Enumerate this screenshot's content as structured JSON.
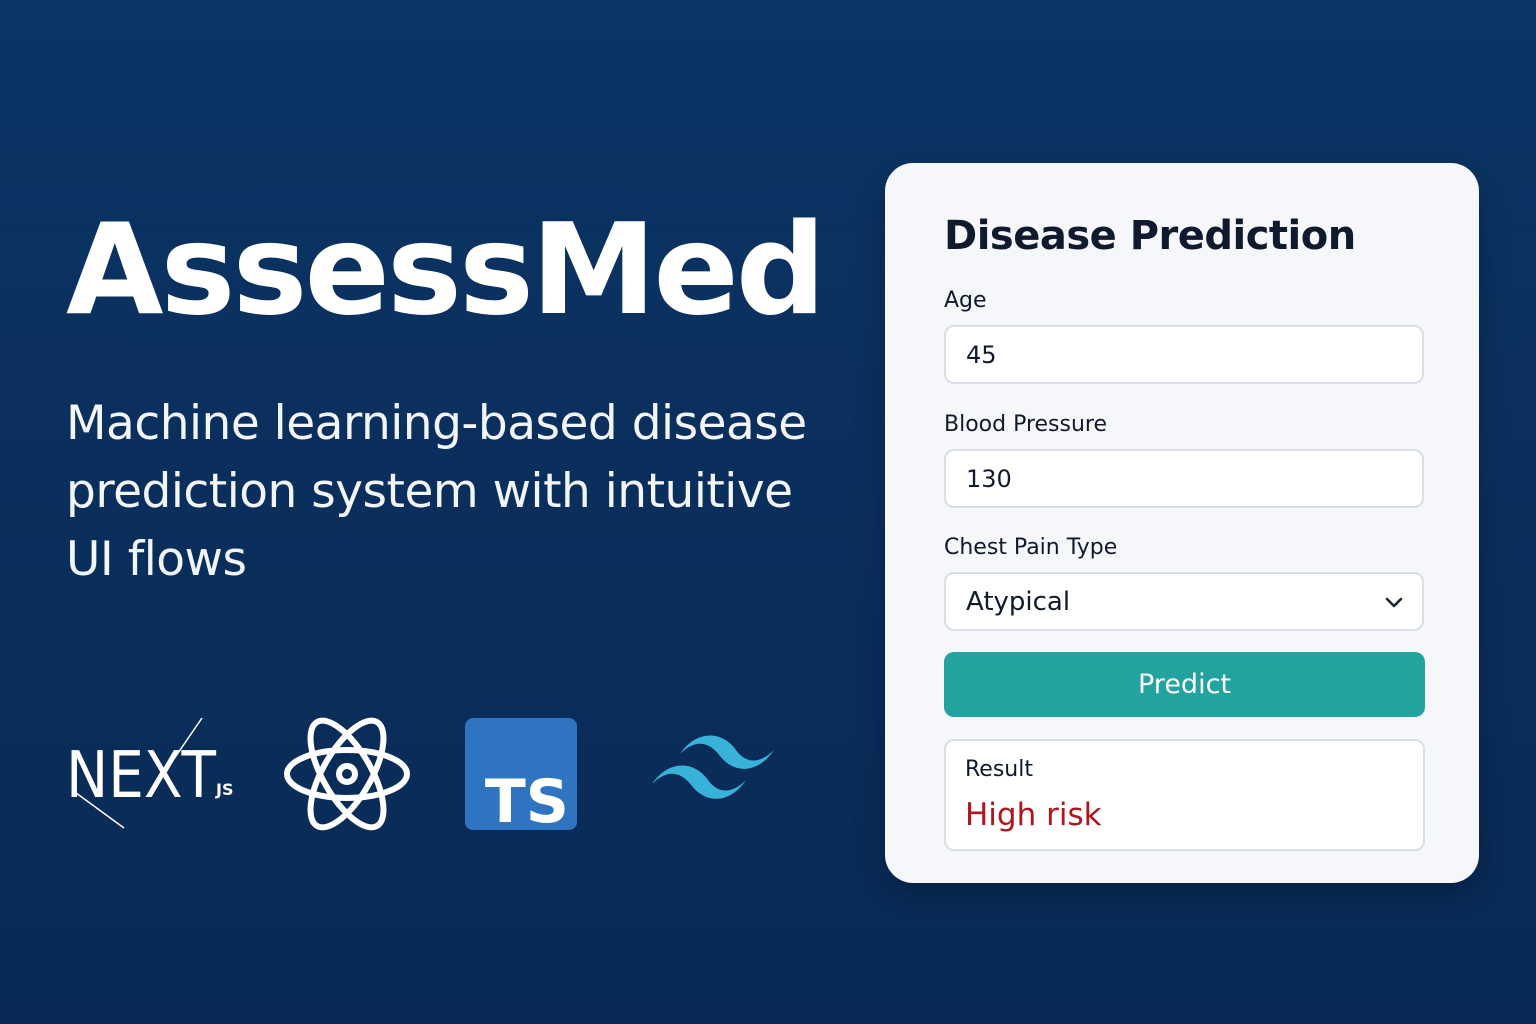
{
  "hero": {
    "title": "AssessMed",
    "tagline": "Machine learning-based disease prediction system with intuitive UI flows"
  },
  "logos": {
    "nextjs": {
      "icon": "nextjs-logo",
      "text": "NEXT",
      "suffix": "JS"
    },
    "react": {
      "icon": "react-logo"
    },
    "typescript": {
      "icon": "typescript-logo",
      "text": "TS"
    },
    "tailwind": {
      "icon": "tailwind-logo"
    }
  },
  "form": {
    "title": "Disease Prediction",
    "fields": {
      "age": {
        "label": "Age",
        "value": "45"
      },
      "blood_pressure": {
        "label": "Blood Pressure",
        "value": "130"
      },
      "chest_pain": {
        "label": "Chest Pain Type",
        "value": "Atypical"
      }
    },
    "predict_label": "Predict",
    "result": {
      "label": "Result",
      "value": "High risk"
    }
  },
  "colors": {
    "background": "#0b2f5c",
    "card": "#f5f7fb",
    "accent": "#22a39f",
    "risk": "#b3131b",
    "typescript": "#2f74c0",
    "tailwind": "#38b2d8"
  }
}
